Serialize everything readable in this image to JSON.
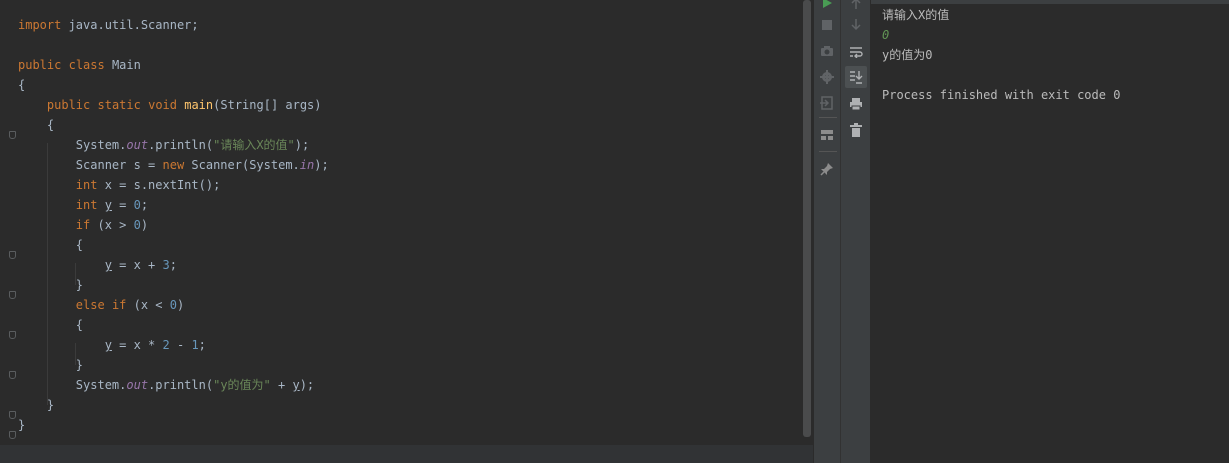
{
  "editor": {
    "code": {
      "import": "import",
      "import_path": " java.util.Scanner;",
      "public": "public",
      "class": "class",
      "class_name": " Main",
      "open_brace": "{",
      "close_brace": "}",
      "static": "static",
      "void": "void",
      "main": "main",
      "main_params": "(String[] args)",
      "system": "System.",
      "out": "out",
      "println": ".println(",
      "str_prompt": "\"请输入X的值\"",
      "close_stmt": ");",
      "scanner_decl": "Scanner s = ",
      "new": "new",
      "scanner_ctor": " Scanner(System.",
      "in": "in",
      "int": "int",
      "x_assign": " x = s.nextInt();",
      "y": "y",
      "eq": " = ",
      "zero": "0",
      "semi": ";",
      "if": "if",
      "else": "else",
      "cond_gt": " (x > ",
      "cond_lt": " (x < ",
      "close_paren": ")",
      "y_eq_x": " = x + ",
      "three": "3",
      "y_eq_x2": " = x * ",
      "two": "2",
      "minus": " - ",
      "one": "1",
      "str_result": "\"y的值为\"",
      "plus": " + "
    }
  },
  "toolbar": {
    "run_icon": "run-icon",
    "stop_icon": "stop-icon",
    "dump_icon": "camera-icon",
    "settings_icon": "gear-icon",
    "exit_icon": "exit-icon",
    "layout_icon": "layout-icon",
    "pin_icon": "pin-icon",
    "up_icon": "arrow-up-icon",
    "down_icon": "arrow-down-icon",
    "wrap_icon": "soft-wrap-icon",
    "scroll_end_icon": "scroll-to-end-icon",
    "print_icon": "print-icon",
    "trash_icon": "trash-icon"
  },
  "console": {
    "line1": "请输入X的值",
    "line2": "0",
    "line3": "y的值为0",
    "line4": "Process finished with exit code 0"
  },
  "colors": {
    "keyword": "#cc7832",
    "function": "#ffc66d",
    "string": "#6a8759",
    "field": "#9876aa",
    "number": "#6897bb",
    "text": "#a9b7c6",
    "input_echo": "#629755"
  }
}
